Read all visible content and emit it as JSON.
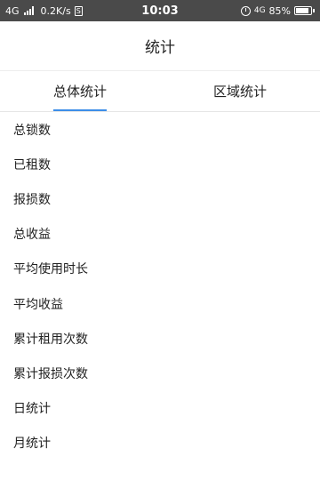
{
  "status_bar": {
    "network": "4G",
    "speed": "0.2K/s",
    "sim_badge": "S",
    "time": "10:03",
    "network_right": "4G",
    "battery": "85%",
    "battery_level": 0.85,
    "icons": [
      "signal-icon",
      "alarm-icon",
      "battery-icon"
    ]
  },
  "header": {
    "title": "统计"
  },
  "tabs": [
    {
      "label": "总体统计",
      "active": true
    },
    {
      "label": "区域统计",
      "active": false
    }
  ],
  "colors": {
    "accent": "#3d8ee8",
    "status_bar_bg": "#4a4a4a"
  },
  "stats": {
    "items": [
      {
        "label": "总锁数"
      },
      {
        "label": "已租数"
      },
      {
        "label": "报损数"
      },
      {
        "label": "总收益"
      },
      {
        "label": "平均使用时长"
      },
      {
        "label": "平均收益"
      },
      {
        "label": "累计租用次数"
      },
      {
        "label": "累计报损次数"
      },
      {
        "label": "日统计"
      },
      {
        "label": "月统计"
      }
    ]
  }
}
